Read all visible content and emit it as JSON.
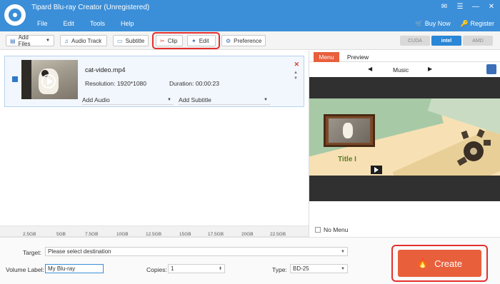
{
  "window": {
    "title": "Tipard Blu-ray Creator (Unregistered)",
    "menu": [
      "File",
      "Edit",
      "Tools",
      "Help"
    ],
    "controls": [
      "✉",
      "☰",
      "—",
      "✕"
    ],
    "account": {
      "buy": "Buy Now",
      "register": "Register"
    }
  },
  "toolbar": {
    "add_files": "Add Files",
    "audio_track": "Audio Track",
    "subtitle": "Subtitle",
    "clip": "Clip",
    "edit": "Edit",
    "preference": "Preference",
    "gpu": {
      "cuda": "CUDA",
      "intel": "intel",
      "amd": "AMD"
    }
  },
  "file": {
    "name": "cat-video.mp4",
    "resolution": "Resolution:  1920*1080",
    "duration": "Duration:  00:00:23",
    "add_audio": "Add Audio",
    "add_subtitle": "Add Subtitle"
  },
  "capacity": {
    "ticks": [
      "2.5GB",
      "5GB",
      "7.5GB",
      "10GB",
      "12.5GB",
      "15GB",
      "17.5GB",
      "20GB",
      "22.5GB"
    ]
  },
  "output": {
    "target_label": "Target:",
    "target_placeholder": "Please select destination",
    "volume_label": "Volume Label:",
    "volume_value": "My Blu-ray",
    "copies_label": "Copies:",
    "copies_value": "1",
    "type_label": "Type:",
    "type_value": "BD-25",
    "create": "Create"
  },
  "preview": {
    "tabs": [
      "Menu",
      "Preview"
    ],
    "music": "Music",
    "menu_title": "Title I",
    "no_menu": "No Menu"
  },
  "colors": {
    "accent": "#3b8ed8",
    "create": "#e85f3c",
    "highlight": "#e4302f"
  }
}
